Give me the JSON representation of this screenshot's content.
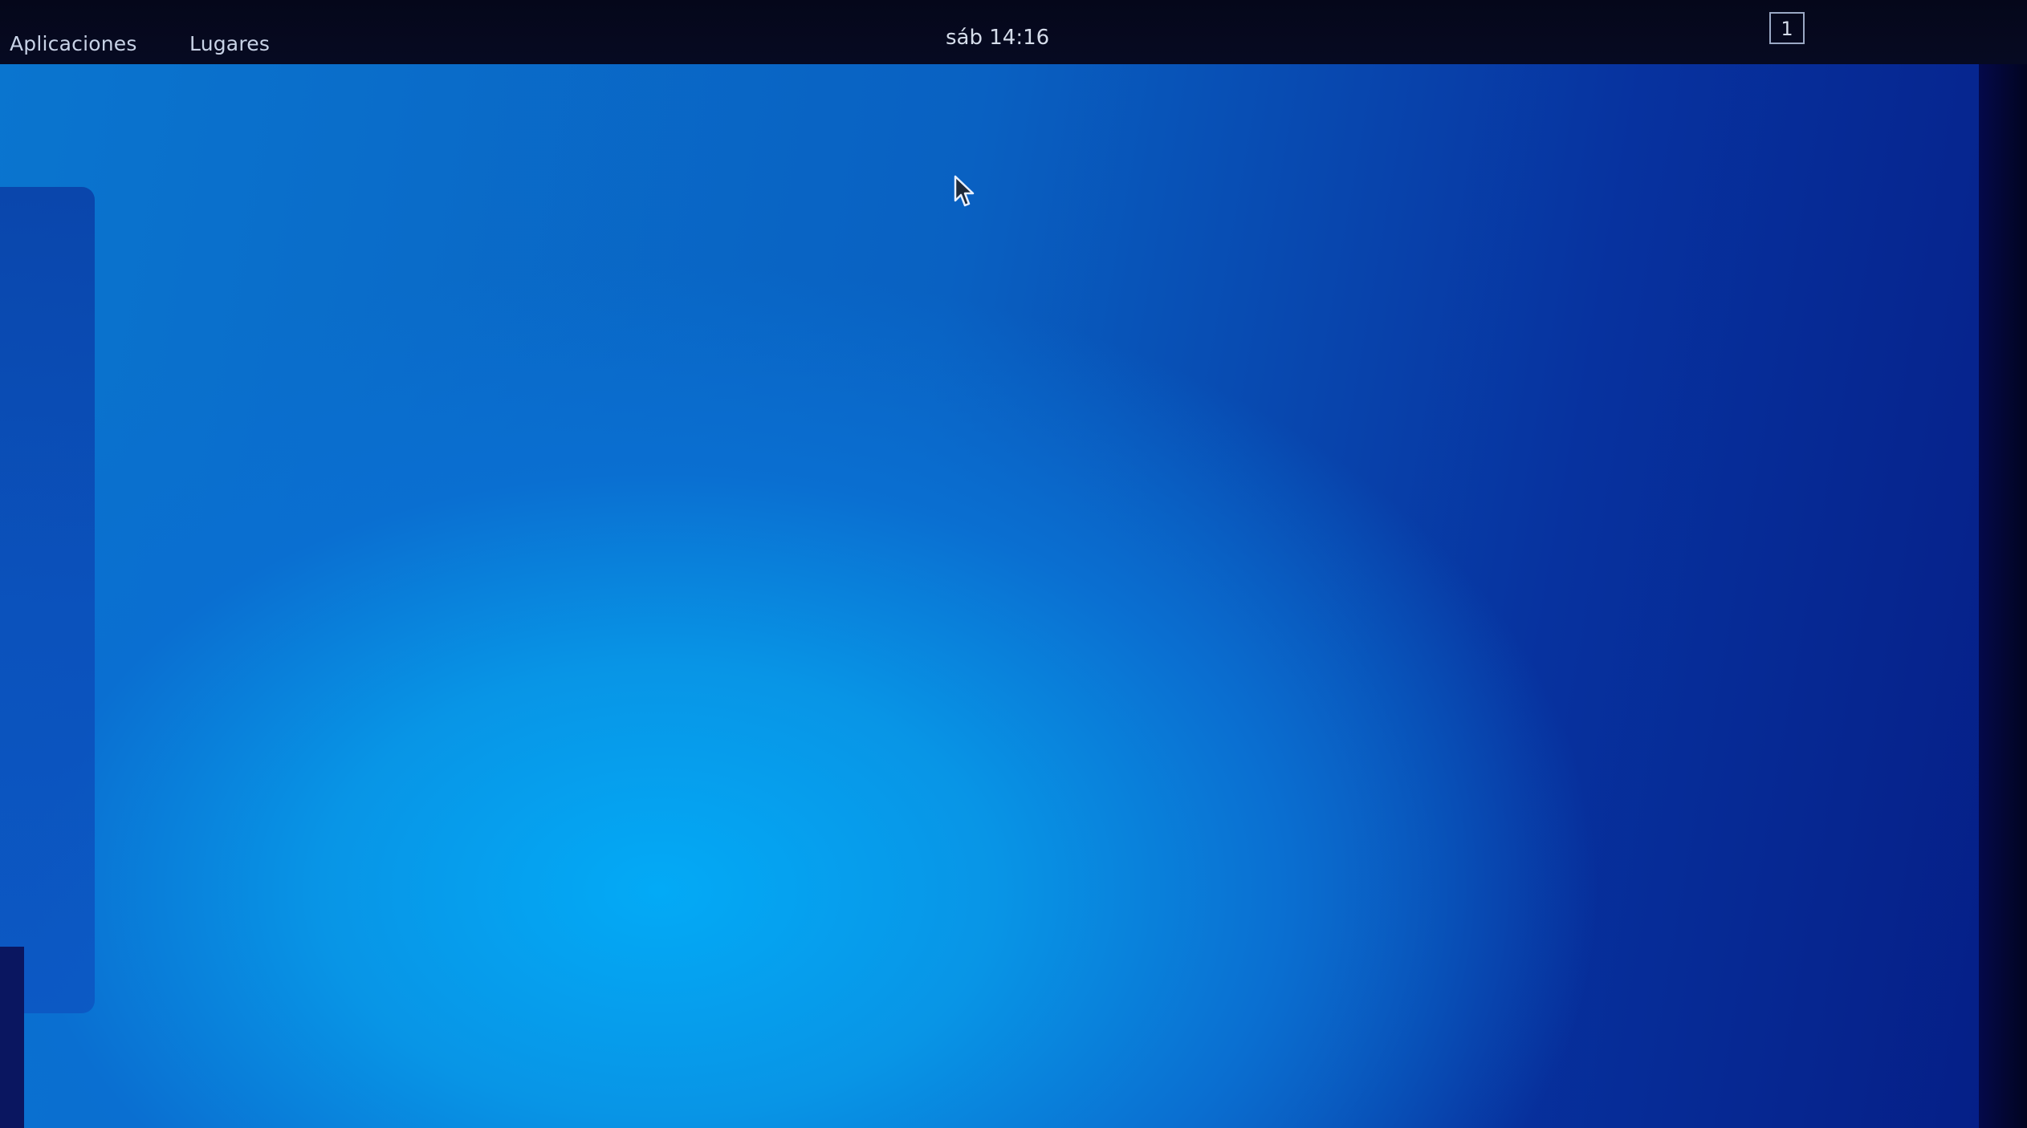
{
  "top_panel": {
    "applications_menu": "Aplicaciones",
    "places_menu": "Lugares",
    "clock": "sáb 14:16",
    "workspace_indicator": "1"
  },
  "icons": {
    "pointer": "mouse-pointer-icon"
  },
  "colors": {
    "panel": "#05071a",
    "wallpaper_light": "#03aaf6",
    "wallpaper_dark": "#051e86"
  }
}
